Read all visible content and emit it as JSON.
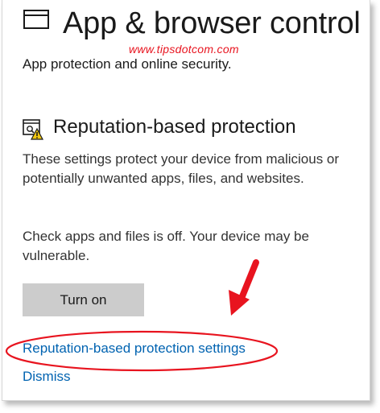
{
  "header": {
    "title": "App & browser control",
    "icon": "app-window-icon"
  },
  "watermark": "www.tipsdotcom.com",
  "subtitle": "App protection and online security.",
  "reputation": {
    "title": "Reputation-based protection",
    "icon": "reputation-warning-icon",
    "description": "These settings protect your device from malicious or potentially unwanted apps, files, and websites.",
    "status": "Check apps and files is off. Your device may be vulnerable.",
    "turn_on_label": "Turn on",
    "settings_link": "Reputation-based protection settings",
    "dismiss_link": "Dismiss"
  },
  "colors": {
    "link": "#0063b1",
    "annotation": "#e8141f",
    "button": "#cccccc",
    "warning": "#f2c811"
  }
}
